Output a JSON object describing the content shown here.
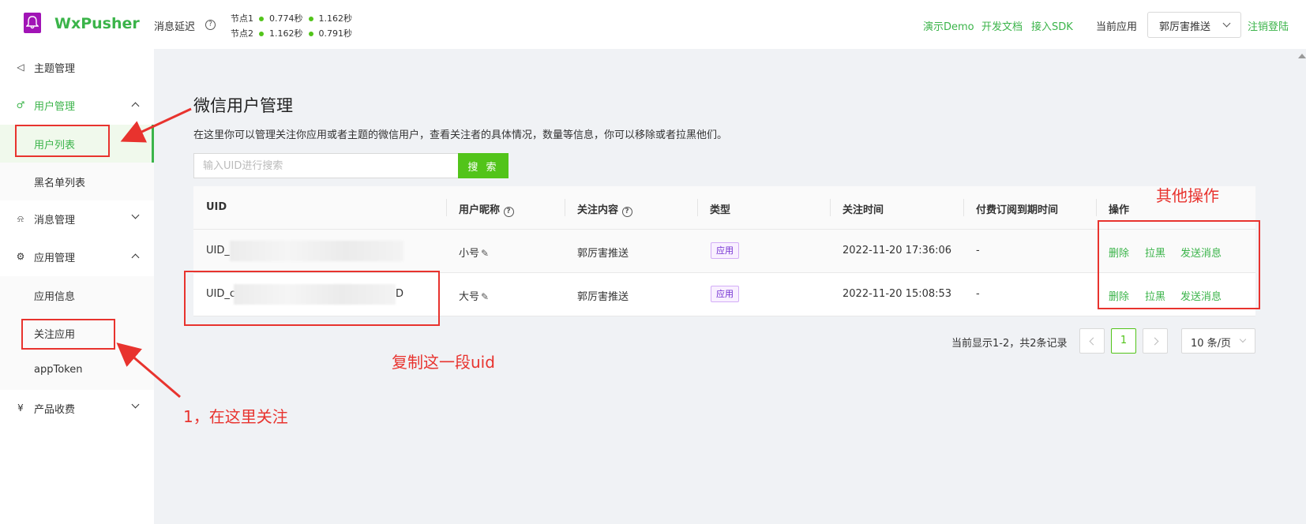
{
  "header": {
    "brand": "WxPusher",
    "latency_label": "消息延迟",
    "nodes": [
      {
        "name": "节点1",
        "v1": "0.774秒",
        "v2": "1.162秒"
      },
      {
        "name": "节点2",
        "v1": "1.162秒",
        "v2": "0.791秒"
      }
    ],
    "links": [
      "演示Demo",
      "开发文档",
      "接入SDK"
    ],
    "current_app_label": "当前应用",
    "current_app_value": "郭厉害推送",
    "logout": "注销登陆"
  },
  "sidebar": {
    "items": [
      {
        "label": "主题管理",
        "icon": "megaphone-icon"
      },
      {
        "label": "用户管理",
        "icon": "users-icon"
      },
      {
        "label": "消息管理",
        "icon": "bell-icon"
      },
      {
        "label": "应用管理",
        "icon": "gear-icon"
      },
      {
        "label": "产品收费",
        "icon": "yen-icon"
      }
    ],
    "user_sub": [
      "用户列表",
      "黑名单列表"
    ],
    "app_sub": [
      "应用信息",
      "关注应用",
      "appToken"
    ]
  },
  "main": {
    "title": "微信用户管理",
    "description": "在这里你可以管理关注你应用或者主题的微信用户，查看关注者的具体情况，数量等信息，你可以移除或者拉黑他们。",
    "search_placeholder": "输入UID进行搜索",
    "search_button": "搜 索",
    "columns": [
      "UID",
      "用户昵称",
      "关注内容",
      "类型",
      "关注时间",
      "付费订阅到期时间",
      "操作"
    ],
    "rows": [
      {
        "uid_prefix": "UID_",
        "uid_suffix": "",
        "nickname": "小号",
        "content": "郭厉害推送",
        "type": "应用",
        "time": "2022-11-20 17:36:06",
        "expire": "-",
        "actions": [
          "删除",
          "拉黑",
          "发送消息"
        ]
      },
      {
        "uid_prefix": "UID_c",
        "uid_suffix": "D",
        "nickname": "大号",
        "content": "郭厉害推送",
        "type": "应用",
        "time": "2022-11-20 15:08:53",
        "expire": "-",
        "actions": [
          "删除",
          "拉黑",
          "发送消息"
        ]
      }
    ],
    "pagination": {
      "info": "当前显示1-2，共2条记录",
      "current": "1",
      "page_size": "10 条/页"
    }
  },
  "annotations": {
    "other_ops": "其他操作",
    "copy_uid": "复制这一段uid",
    "follow_here": "1，在这里关注"
  },
  "colors": {
    "accent": "#3bb44a",
    "annotation": "#e8332e",
    "tag": "#722ed1"
  }
}
